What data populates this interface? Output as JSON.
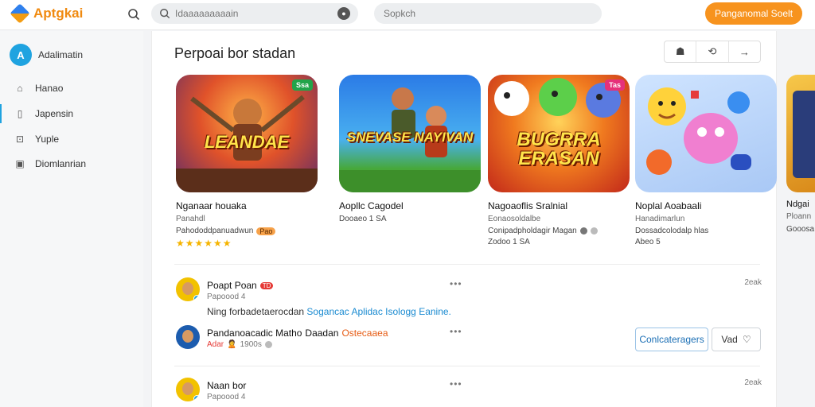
{
  "app": {
    "name": "Aptgkai"
  },
  "search": {
    "placeholder": "Idaaaaaaaaain",
    "mic_label": "●"
  },
  "search2": {
    "placeholder": "Sopkch"
  },
  "cta": {
    "label": "Panganomal Soelt"
  },
  "sidebar": {
    "profile": {
      "name": "Adalimatin",
      "icon": "A"
    },
    "items": [
      {
        "label": "Hanao",
        "icon": "home-icon"
      },
      {
        "label": "Japensin",
        "icon": "bookmark-icon"
      },
      {
        "label": "Yuple",
        "icon": "grid-icon"
      },
      {
        "label": "Diomlanrian",
        "icon": "calendar-icon"
      }
    ]
  },
  "section": {
    "title": "Perpoai bor stadan",
    "toolbar": [
      "☗",
      "⟲",
      "→"
    ]
  },
  "games": [
    {
      "title_art": "LEANDAE",
      "badge": "Ssa",
      "name": "Nganaar houaka",
      "sub": "Panahdl",
      "sub2": "Pahododdpanuadwun",
      "tag": "Pao",
      "stars": "★★★★★★"
    },
    {
      "title_art": "SNEVASE NAYIVAN",
      "badge": "",
      "name": "Aopllc Cagodel",
      "sub": "",
      "sub2": "Dooaeo 1 SA",
      "tag": "",
      "stars": ""
    },
    {
      "title_art": "BUGRRA ERASAN",
      "badge": "Tas",
      "name": "Nagoaoflis Sralnial",
      "sub": "Eonaosoldalbe",
      "sub2": "Conipadpholdagir Magan",
      "tag": "",
      "stars": "",
      "sub3": "Zodoo 1 SA"
    },
    {
      "title_art": "",
      "badge": "",
      "name": "Noplal Aoabaali",
      "sub": "Hanadimarlun",
      "sub2": "Dossadcolodalp hlas",
      "tag": "",
      "stars": "",
      "sub3": "Abeo 5"
    }
  ],
  "right_partial": {
    "name": "Ndgai",
    "sub": "Ploann",
    "sub2": "Gooosa"
  },
  "posts": [
    {
      "name": "Poapt Poan",
      "flag": "TD",
      "sub": "Papoood 4",
      "more": "•••",
      "time": "2eak",
      "text_plain": "Ning forbadetaerocdan ",
      "text_link1": "Sogancac",
      "text_mid": " ",
      "text_link2": "Aplidac Isologg Eanine."
    },
    {
      "name": "Pandanoacadic Matho",
      "name2": "Daadan",
      "tag": "Ostecaaea",
      "sub_red": "Adar",
      "sub_icon": "🙎",
      "sub": "1900s",
      "more": "•••",
      "time": ""
    },
    {
      "name": "Naan bor",
      "sub": "Papoood 4",
      "more": "•••",
      "time": "2eak"
    }
  ],
  "buttons": {
    "follow": "Conlcateragers",
    "vote": "Vad",
    "vote_icon": "♡"
  }
}
